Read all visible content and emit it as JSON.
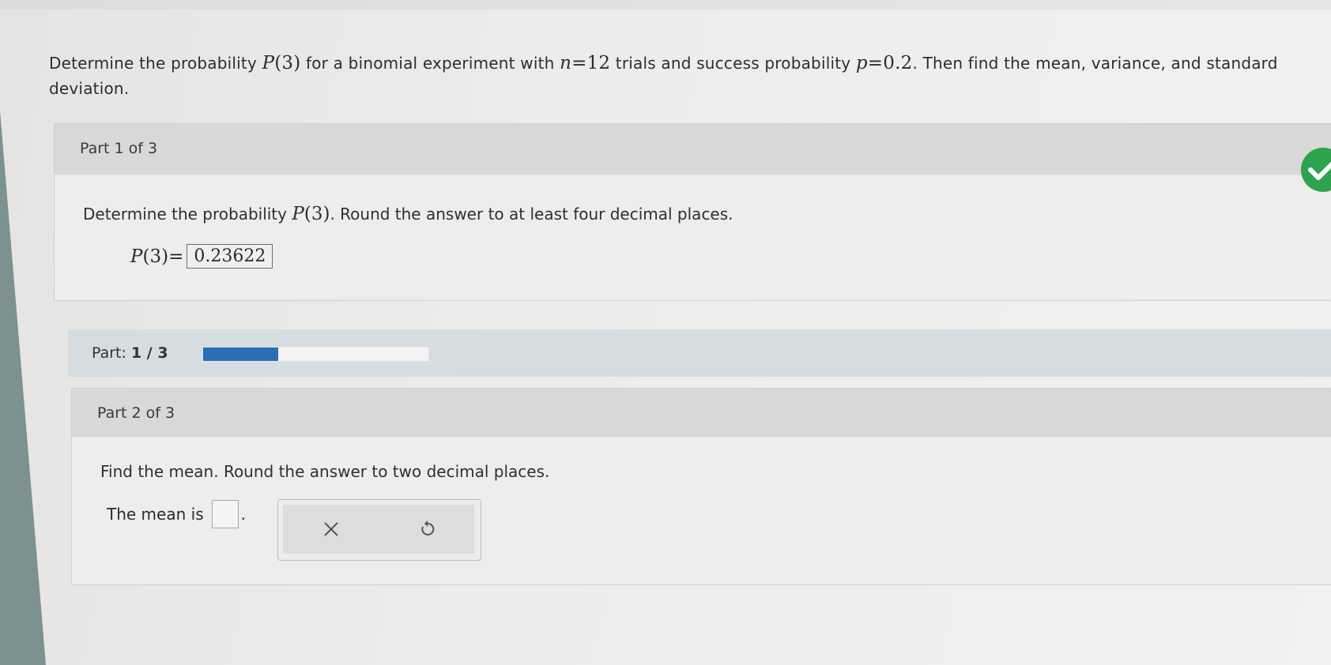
{
  "problem": {
    "intro": "Determine the probability",
    "p_expr": "P",
    "p_arg": "(3)",
    "mid1": "for a binomial experiment with",
    "n_var": "n",
    "n_eq": "=12",
    "mid2": "trials and success probability",
    "p_var": "p",
    "p_eq": "=0.2",
    "tail": ". Then find the mean, variance, and standard deviation."
  },
  "part1": {
    "header": "Part 1 of 3",
    "question_prefix": "Determine the probability",
    "question_expr": "P",
    "question_arg": "(3)",
    "question_suffix": ". Round the answer to at least four decimal places.",
    "answer_label_var": "P",
    "answer_label_rest": "(3)=",
    "answer_value": "0.23622",
    "status": "correct"
  },
  "progress": {
    "label": "Part:",
    "value": "1 / 3",
    "fraction": 0.3333
  },
  "part2": {
    "header": "Part 2 of 3",
    "question": "Find the mean. Round the answer to two decimal places.",
    "answer_prefix": "The mean is",
    "answer_suffix": ".",
    "answer_value": ""
  },
  "tools": {
    "clear_icon": "close-icon",
    "undo_icon": "undo-icon"
  },
  "colors": {
    "check": "#2ea34e",
    "progress_fill": "#2a6fb4"
  }
}
